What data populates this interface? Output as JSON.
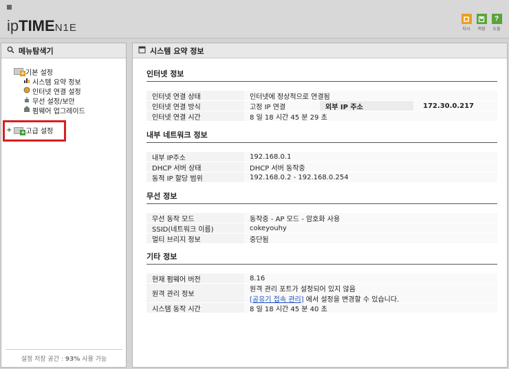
{
  "header": {
    "logo": {
      "ip": "ip",
      "time": "TIME",
      "model": "N1E"
    },
    "toolbar": [
      {
        "name": "refresh",
        "label": "다시",
        "color": "#e8a020",
        "icon_name": "refresh-icon"
      },
      {
        "name": "save",
        "label": "저장",
        "color": "#58a43a",
        "icon_name": "save-icon"
      },
      {
        "name": "help",
        "label": "도움",
        "color": "#58a43a",
        "icon_name": "help-icon",
        "glyph": "?"
      }
    ]
  },
  "sidebar": {
    "title": "메뉴탐색기",
    "basic": {
      "label": "기본 설정",
      "items": [
        {
          "label": "시스템 요약 정보",
          "icon_name": "chart-icon"
        },
        {
          "label": "인터넷 연결 설정",
          "icon_name": "globe-icon"
        },
        {
          "label": "무선 설정/보안",
          "icon_name": "wireless-icon"
        },
        {
          "label": "펌웨어 업그레이드",
          "icon_name": "firmware-icon"
        }
      ]
    },
    "advanced": {
      "expander": "+",
      "label": "고급 설정"
    },
    "footer": {
      "prefix": "설정 저장 공간 : ",
      "percent": "93%",
      "suffix": " 사용 가능"
    }
  },
  "main": {
    "title": "시스템 요약 정보",
    "internet": {
      "title": "인터넷 정보",
      "status_label": "인터넷 연결 상태",
      "status_value": "인터넷에 정상적으로 연결됨",
      "method_label": "인터넷 연결 방식",
      "method_value": "고정 IP 연결",
      "external_ip_label": "외부 IP 주소",
      "external_ip_value": "172.30.0.217",
      "time_label": "인터넷 연결 시간",
      "time_value": "8 일 18 시간 45 분 29 초"
    },
    "lan": {
      "title": "내부 네트워크 정보",
      "ip_label": "내부 IP주소",
      "ip_value": "192.168.0.1",
      "dhcp_label": "DHCP 서버 상태",
      "dhcp_value": "DHCP 서버 동작중",
      "range_label": "동적 IP 할당 범위",
      "range_value": "192.168.0.2 -  192.168.0.254"
    },
    "wireless": {
      "title": "무선 정보",
      "mode_label": "무선 동작 모드",
      "mode_value": "동작중 - AP 모드 - 암호화 사용",
      "ssid_label": "SSID(네트워크 이름)",
      "ssid_value": "cokeyouhy",
      "bridge_label": "멀티 브리지 정보",
      "bridge_value": "중단됨"
    },
    "etc": {
      "title": "기타 정보",
      "fw_label": "현재 펌웨어 버전",
      "fw_value": "8.16",
      "remote_label": "원격 관리 정보",
      "remote_line1": "원격 관리 포트가 설정되어 있지 않음",
      "remote_link": "[공유기 접속 관리]",
      "remote_line2_suffix": " 에서 설정을 변경할 수 있습니다.",
      "uptime_label": "시스템 동작 시간",
      "uptime_value": "8 일 18 시간 45 분 40 초"
    }
  }
}
